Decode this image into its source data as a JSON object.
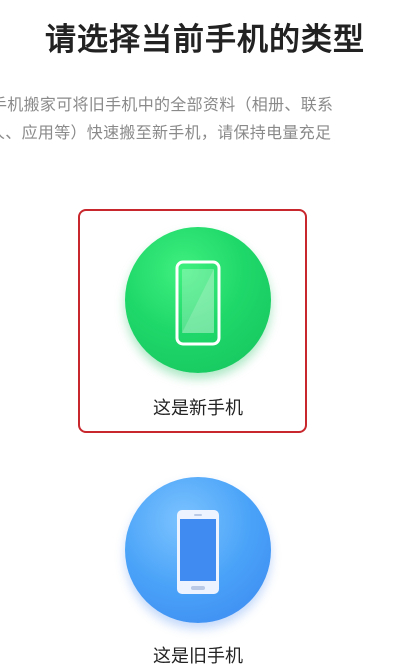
{
  "header": {
    "title": "请选择当前手机的类型"
  },
  "description": {
    "line1": "手机搬家可将旧手机中的全部资料（相册、联系",
    "line2": "人、应用等）快速搬至新手机，请保持电量充足"
  },
  "options": {
    "new_phone": {
      "label": "这是新手机",
      "selected": true,
      "icon": "phone-icon",
      "color": "#1fd86a"
    },
    "old_phone": {
      "label": "这是旧手机",
      "selected": false,
      "icon": "phone-icon",
      "color": "#4aa3f8"
    }
  },
  "colors": {
    "selection_border": "#c8272d",
    "title_text": "#222222",
    "description_text": "#8a8a8a"
  }
}
